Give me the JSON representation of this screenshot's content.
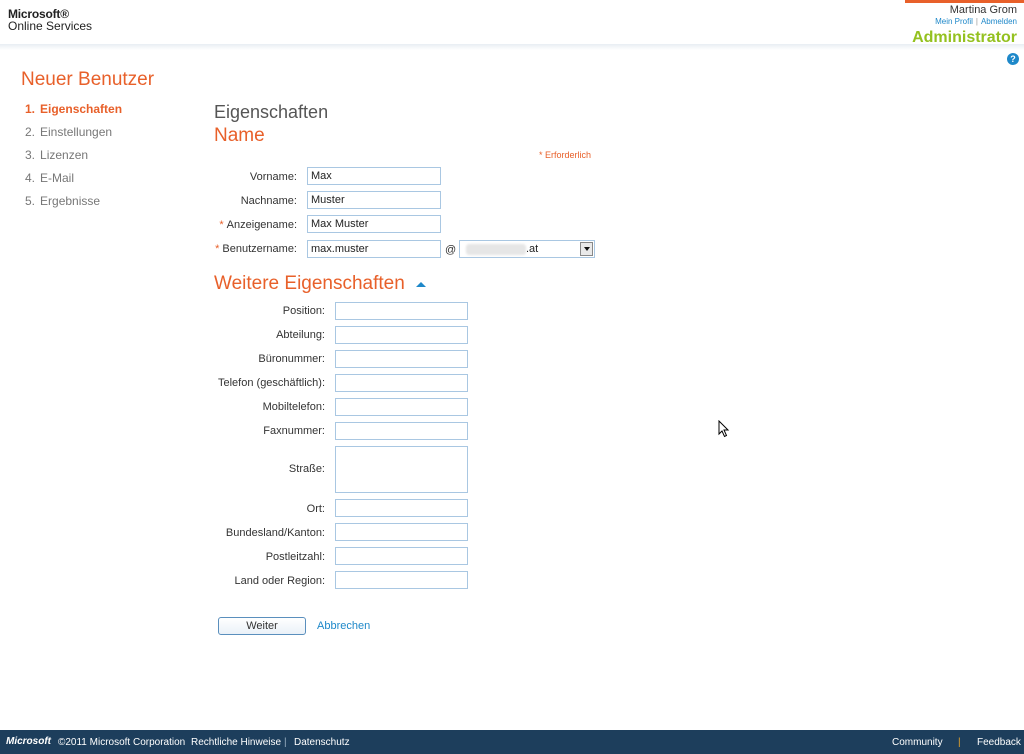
{
  "header": {
    "logo_line1": "Microsoft®",
    "logo_line2": "Online Services",
    "user_name": "Martina Grom",
    "profile_link": "Mein Profil",
    "link_separator": "|",
    "signout_link": "Abmelden",
    "role": "Administrator",
    "help_icon": "help-icon"
  },
  "nav": {
    "title": "Neuer Benutzer",
    "steps": [
      {
        "num": "1.",
        "label": "Eigenschaften"
      },
      {
        "num": "2.",
        "label": "Einstellungen"
      },
      {
        "num": "3.",
        "label": "Lizenzen"
      },
      {
        "num": "4.",
        "label": "E-Mail"
      },
      {
        "num": "5.",
        "label": "Ergebnisse"
      }
    ]
  },
  "form": {
    "section_title": "Eigenschaften",
    "name_title": "Name",
    "required_note": "* Erforderlich",
    "required_marker": "*",
    "first_name": {
      "label": "Vorname:",
      "value": "Max"
    },
    "last_name": {
      "label": "Nachname:",
      "value": "Muster"
    },
    "display_name": {
      "label": "Anzeigename:",
      "value": "Max Muster"
    },
    "user_name": {
      "label": "Benutzername:",
      "value": "max.muster"
    },
    "at_sign": "@",
    "domain_suffix": ".at",
    "more_title": "Weitere Eigenschaften",
    "more_fields": {
      "position": {
        "label": "Position:",
        "value": ""
      },
      "department": {
        "label": "Abteilung:",
        "value": ""
      },
      "office": {
        "label": "Büronummer:",
        "value": ""
      },
      "phone": {
        "label": "Telefon (geschäftlich):",
        "value": ""
      },
      "mobile": {
        "label": "Mobiltelefon:",
        "value": ""
      },
      "fax": {
        "label": "Faxnummer:",
        "value": ""
      },
      "street": {
        "label": "Straße:",
        "value": ""
      },
      "city": {
        "label": "Ort:",
        "value": ""
      },
      "state": {
        "label": "Bundesland/Kanton:",
        "value": ""
      },
      "zip": {
        "label": "Postleitzahl:",
        "value": ""
      },
      "country": {
        "label": "Land oder Region:",
        "value": ""
      }
    },
    "next_button": "Weiter",
    "cancel_link": "Abbrechen"
  },
  "footer": {
    "logo": "Microsoft",
    "copyright": "©2011 Microsoft Corporation",
    "legal": "Rechtliche Hinweise",
    "separator": "|",
    "privacy": "Datenschutz",
    "community": "Community",
    "feedback": "Feedback"
  },
  "colors": {
    "accent_orange": "#e8602a",
    "link_blue": "#1e88c9",
    "role_green": "#94c11f",
    "footer_bg": "#1d3e5c"
  }
}
